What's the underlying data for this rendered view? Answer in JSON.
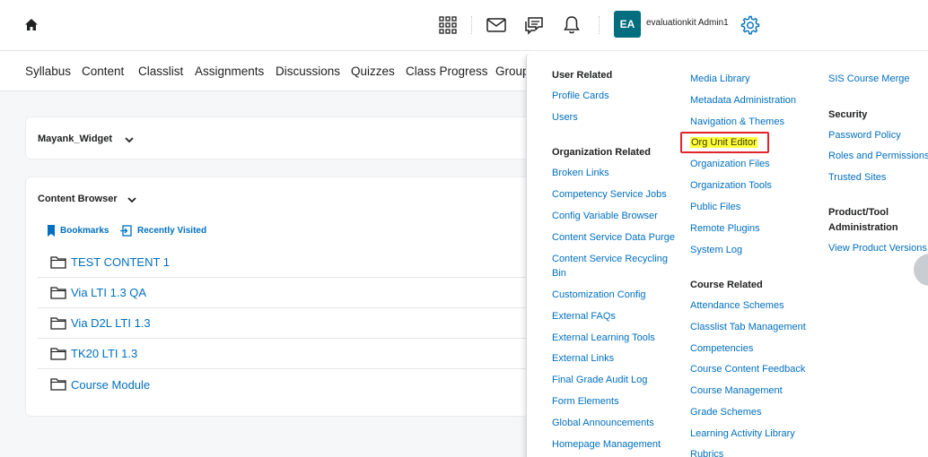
{
  "topbar": {
    "user_initials": "EA",
    "user_name": "evaluationkit Admin1",
    "icons": [
      "home-icon",
      "grid-icon",
      "mail-icon",
      "chat-icon",
      "bell-icon",
      "gear-icon"
    ]
  },
  "nav": {
    "items": [
      "Syllabus",
      "Content",
      "Classlist",
      "Assignments",
      "Discussions",
      "Quizzes",
      "Class Progress",
      "Group"
    ]
  },
  "widget": {
    "title": "Mayank_Widget"
  },
  "content_browser": {
    "title": "Content Browser",
    "bookmarks": "Bookmarks",
    "recently_visited": "Recently Visited",
    "items": [
      "TEST CONTENT 1",
      "Via LTI 1.3 QA",
      "Via D2L LTI 1.3",
      "TK20 LTI 1.3",
      "Course Module"
    ]
  },
  "admin_menu": {
    "col1": {
      "user_related_heading": "User Related",
      "user_related": [
        "Profile Cards",
        "Users"
      ],
      "org_related_heading": "Organization Related",
      "org_related": [
        "Broken Links",
        "Competency Service Jobs",
        "Config Variable Browser",
        "Content Service Data Purge",
        "Content Service Recycling",
        "Bin",
        "Customization Config",
        "External FAQs",
        "External Learning Tools",
        "External Links",
        "Final Grade Audit Log",
        "Form Elements",
        "Global Announcements",
        "Homepage Management"
      ]
    },
    "col2": {
      "items": [
        "Media Library",
        "Metadata Administration",
        "Navigation & Themes",
        "Org Unit Editor",
        "Organization Files",
        "Organization Tools",
        "Public Files",
        "Remote Plugins",
        "System Log"
      ],
      "course_related_heading": "Course Related",
      "course_related": [
        "Attendance Schemes",
        "Classlist Tab Management",
        "Competencies",
        "Course Content Feedback",
        "Course Management",
        "Grade Schemes",
        "Learning Activity Library",
        "Rubrics"
      ]
    },
    "col3": {
      "items": [
        "SIS Course Merge"
      ],
      "security_heading": "Security",
      "security": [
        "Password Policy",
        "Roles and Permissions",
        "Trusted Sites"
      ],
      "product_heading_1": "Product/Tool",
      "product_heading_2": "Administration",
      "product": [
        "View Product Versions"
      ]
    },
    "highlight_color": "#ffff3d",
    "highlight_border": "#e0242a"
  },
  "colors": {
    "link": "#006fbf",
    "avatar_bg": "#006e7e"
  }
}
